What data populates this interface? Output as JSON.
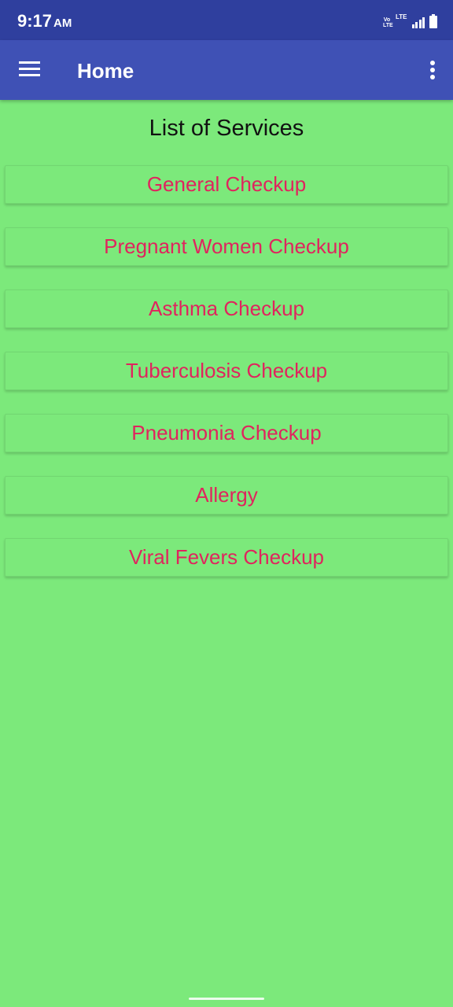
{
  "status_bar": {
    "time": "9:17",
    "ampm": "AM",
    "volte": "Vo LTE",
    "network": "LTE"
  },
  "app_bar": {
    "title": "Home",
    "menu_icon": "hamburger-menu-icon",
    "overflow_icon": "more-vert-icon"
  },
  "main": {
    "heading": "List of Services",
    "services": [
      "General Checkup",
      "Pregnant Women Checkup",
      "Asthma Checkup",
      "Tuberculosis Checkup",
      "Pneumonia Checkup",
      "Allergy",
      "Viral Fevers Checkup"
    ]
  },
  "colors": {
    "status_bar": "#2f3f9e",
    "app_bar": "#3f51b5",
    "background": "#7ce97b",
    "button_text": "#e0245e"
  }
}
